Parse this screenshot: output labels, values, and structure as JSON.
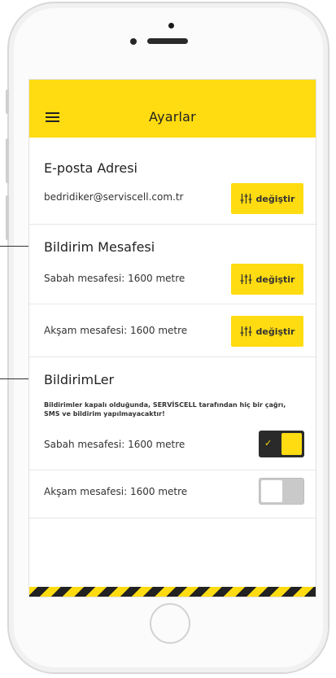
{
  "header": {
    "title": "Ayarlar",
    "menu_icon": "hamburger-menu-icon"
  },
  "email_section": {
    "title": "E-posta Adresi",
    "value": "bedridiker@serviscell.com.tr",
    "button_label": "değiştir",
    "button_icon": "sliders-icon"
  },
  "distance_section": {
    "title": "Bildirim Mesafesi",
    "rows": [
      {
        "label": "Sabah mesafesi: 1600 metre",
        "button_label": "değiştir"
      },
      {
        "label": "Akşam mesafesi: 1600 metre",
        "button_label": "değiştir"
      }
    ]
  },
  "notifications_section": {
    "title": "BildirimLer",
    "note": "Bildirimler kapalı olduğunda, SERVİSCELL tarafından hiç bir çağrı, SMS ve bildirim yapılmayacaktır!",
    "rows": [
      {
        "label": "Sabah mesafesi: 1600 metre",
        "enabled": true
      },
      {
        "label": "Akşam mesafesi: 1600 metre",
        "enabled": false
      }
    ]
  },
  "colors": {
    "accent": "#ffdb11",
    "toggle_on_bg": "#2a2a2a",
    "toggle_off_bg": "#c9c9c9",
    "text": "#222222"
  }
}
